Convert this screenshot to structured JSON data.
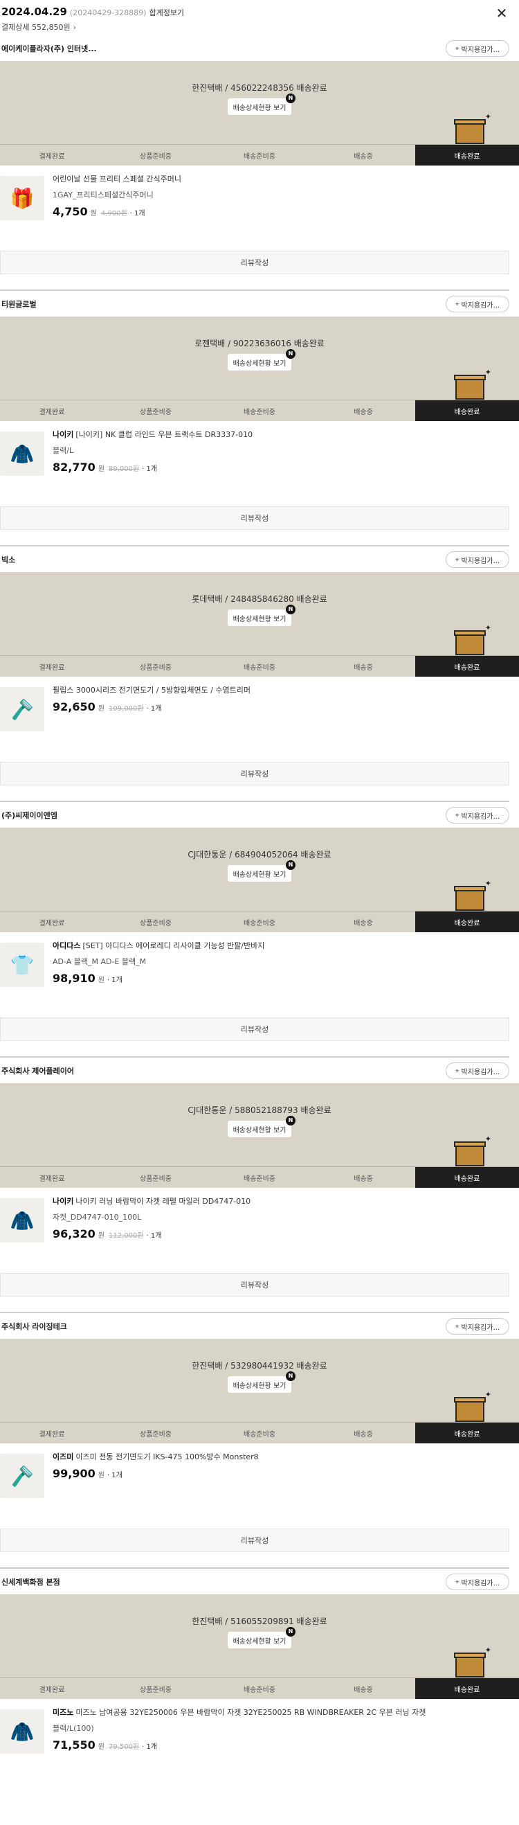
{
  "header": {
    "date": "2024.04.29",
    "order_no": "(20240429-328889)",
    "combined_label": "합계정보기",
    "payment_detail": "결제상세 552,850원",
    "chevron": "›",
    "close": "✕"
  },
  "box_button_label": "박지용김가...",
  "status_button_label": "배송상세현황 보기",
  "n_badge": "N",
  "review_label": "리뷰작성",
  "steps": [
    "결제완료",
    "상품준비중",
    "배송준비중",
    "배송중",
    "배송완료"
  ],
  "active_step_index": 4,
  "won": "원",
  "sellers": [
    {
      "name": "에이케이플라자(주) 인터넷...",
      "tracking": "한진택배 / 456022248356 배송완료",
      "product": {
        "brand": "",
        "name": "어린이날 선물 프리티 스페셜 간식주머니",
        "option": "1GAY_프리티스페셜간식주머니",
        "price": "4,750",
        "original": "4,900원",
        "qty": "· 1개",
        "thumb_icon": "gift-icon",
        "thumb_glyph": "🎁"
      }
    },
    {
      "name": "티원글로벌",
      "tracking": "로젠택배 / 90223636016 배송완료",
      "product": {
        "brand": "나이키",
        "name": "[나이키] NK 클럽 라인드 우븐 트랙수트 DR3337-010",
        "option": "블랙/L",
        "price": "82,770",
        "original": "89,000원",
        "qty": "· 1개",
        "thumb_icon": "tracksuit-icon",
        "thumb_glyph": "🧥"
      }
    },
    {
      "name": "빅소",
      "tracking": "롯데택배 / 248485846280 배송완료",
      "product": {
        "brand": "",
        "name": "필립스 3000시리즈 전기면도기 / 5방향입체면도 / 수염트리머",
        "option": "",
        "price": "92,650",
        "original": "109,000원",
        "qty": "· 1개",
        "thumb_icon": "shaver-icon",
        "thumb_glyph": "🪒"
      }
    },
    {
      "name": "(주)씨제이이엔엠",
      "tracking": "CJ대한통운 / 684904052064 배송완료",
      "product": {
        "brand": "아디다스",
        "name": "[SET] 아디다스 에어로레디 리사이클 기능성 반팔/반바지",
        "option": "AD-A 블랙_M AD-E 블랙_M",
        "price": "98,910",
        "original": "",
        "qty": "· 1개",
        "thumb_icon": "tshirt-icon",
        "thumb_glyph": "👕"
      }
    },
    {
      "name": "주식회사 제어플레이어",
      "tracking": "CJ대한통운 / 588052188793 배송완료",
      "product": {
        "brand": "나이키",
        "name": "나이키 러닝 바람막이 자켓 레펠 마일러 DD4747-010",
        "option": "자켓_DD4747-010_100L",
        "price": "96,320",
        "original": "112,000원",
        "qty": "· 1개",
        "thumb_icon": "jacket-icon",
        "thumb_glyph": "🧥"
      }
    },
    {
      "name": "주식회사 라이징테크",
      "tracking": "한진택배 / 532980441932 배송완료",
      "product": {
        "brand": "이즈미",
        "name": "이즈미 전동 전기면도기 IKS-475 100%방수 Monster8",
        "option": "",
        "price": "99,900",
        "original": "",
        "qty": "· 1개",
        "thumb_icon": "shaver-icon",
        "thumb_glyph": "🪒"
      }
    },
    {
      "name": "신세계백화점 본점",
      "tracking": "한진택배 / 516055209891 배송완료",
      "product": {
        "brand": "미즈노",
        "name": "미즈노 남여공용 32YE250006 우븐 바람막이 자켓 32YE250025 RB WINDBREAKER 2C 우븐 러닝 자켓",
        "option": "블랙/L(100)",
        "price": "71,550",
        "original": "79,500원",
        "qty": "· 1개",
        "thumb_icon": "windbreaker-icon",
        "thumb_glyph": "🧥"
      }
    }
  ]
}
